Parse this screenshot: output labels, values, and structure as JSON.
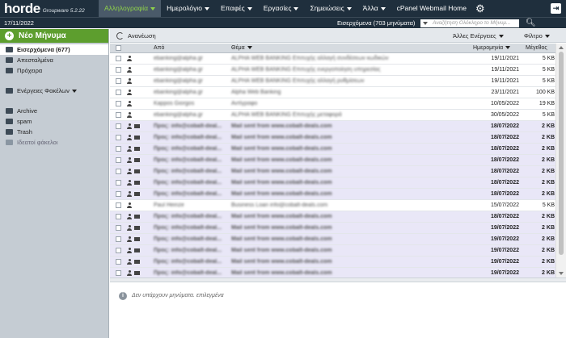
{
  "app": {
    "logo": "horde",
    "version": "Groupware 5.2.22"
  },
  "menu": [
    {
      "label": "Αλληλογραφία",
      "active": true,
      "caret": true
    },
    {
      "label": "Ημερολόγιο",
      "active": false,
      "caret": true
    },
    {
      "label": "Επαφές",
      "active": false,
      "caret": true
    },
    {
      "label": "Εργασίες",
      "active": false,
      "caret": true
    },
    {
      "label": "Σημειώσεις",
      "active": false,
      "caret": true
    },
    {
      "label": "Άλλα",
      "active": false,
      "caret": true
    },
    {
      "label": "cPanel Webmail Home",
      "active": false,
      "caret": false
    }
  ],
  "subbar": {
    "date": "17/11/2022",
    "folder": "Εισερχόμενα (703 μηνύματα)",
    "search_placeholder": "Αναζήτηση  Ολόκληρο το Μήνυμ..."
  },
  "sidebar": {
    "new_message": "Νέο Μήνυμα",
    "folders": [
      {
        "label": "Εισερχόμενα (677)",
        "icon": "inbox-icon",
        "selected": true
      },
      {
        "label": "Απεσταλμένα",
        "icon": "sent-icon",
        "selected": false
      },
      {
        "label": "Πρόχειρα",
        "icon": "drafts-icon",
        "selected": false
      }
    ],
    "folder_actions": "Ενέργειες Φακέλων",
    "extra": [
      {
        "label": "Archive",
        "icon": "folder-icon"
      },
      {
        "label": "spam",
        "icon": "folder-icon"
      },
      {
        "label": "Trash",
        "icon": "folder-icon"
      }
    ],
    "virtual": "Ιδεατοί φάκελοι"
  },
  "toolbar": {
    "refresh": "Ανανέωση",
    "other_actions": "Άλλες Ενέργειες",
    "filter": "Φίλτρο"
  },
  "headers": {
    "from": "Από",
    "subject": "Θέμα",
    "date": "Ημερομηνία",
    "size": "Μέγεθος"
  },
  "messages": [
    {
      "from": "ebanking@alpha.gr",
      "subject": "ALPHA WEB BANKING Επιτυχής αλλαγή συνδέσεων κωδικών",
      "date": "19/11/2021",
      "size": "5 KB",
      "unread": false,
      "envelope": false
    },
    {
      "from": "ebanking@alpha.gr",
      "subject": "ALPHA WEB BANKING Επιτυχής ενεργοποίηση υπηρεσίας",
      "date": "19/11/2021",
      "size": "5 KB",
      "unread": false,
      "envelope": false
    },
    {
      "from": "ebanking@alpha.gr",
      "subject": "ALPHA WEB BANKING Επιτυχής αλλαγή ρυθμίσεων",
      "date": "19/11/2021",
      "size": "5 KB",
      "unread": false,
      "envelope": false
    },
    {
      "from": "ebanking@alpha.gr",
      "subject": "Alpha Web Banking",
      "date": "23/11/2021",
      "size": "100 KB",
      "unread": false,
      "envelope": false
    },
    {
      "from": "Kappos Giorgos",
      "subject": "Αντίγραφο",
      "date": "10/05/2022",
      "size": "19 KB",
      "unread": false,
      "envelope": false
    },
    {
      "from": "ebanking@alpha.gr",
      "subject": "ALPHA WEB BANKING Επιτυχής μεταφορά",
      "date": "30/05/2022",
      "size": "5 KB",
      "unread": false,
      "envelope": false
    },
    {
      "from": "Προς: info@cobalt-deal...",
      "subject": "Mail sent from www.cobalt-deals.com",
      "date": "18/07/2022",
      "size": "2 KB",
      "unread": true,
      "envelope": true
    },
    {
      "from": "Προς: info@cobalt-deal...",
      "subject": "Mail sent from www.cobalt-deals.com",
      "date": "18/07/2022",
      "size": "2 KB",
      "unread": true,
      "envelope": true
    },
    {
      "from": "Προς: info@cobalt-deal...",
      "subject": "Mail sent from www.cobalt-deals.com",
      "date": "18/07/2022",
      "size": "2 KB",
      "unread": true,
      "envelope": true
    },
    {
      "from": "Προς: info@cobalt-deal...",
      "subject": "Mail sent from www.cobalt-deals.com",
      "date": "18/07/2022",
      "size": "2 KB",
      "unread": true,
      "envelope": true
    },
    {
      "from": "Προς: info@cobalt-deal...",
      "subject": "Mail sent from www.cobalt-deals.com",
      "date": "18/07/2022",
      "size": "2 KB",
      "unread": true,
      "envelope": true
    },
    {
      "from": "Προς: info@cobalt-deal...",
      "subject": "Mail sent from www.cobalt-deals.com",
      "date": "18/07/2022",
      "size": "2 KB",
      "unread": true,
      "envelope": true
    },
    {
      "from": "Προς: info@cobalt-deal...",
      "subject": "Mail sent from www.cobalt-deals.com",
      "date": "18/07/2022",
      "size": "2 KB",
      "unread": true,
      "envelope": true
    },
    {
      "from": "Paul Heinze",
      "subject": "Business Loan info@cobalt-deals.com",
      "date": "15/07/2022",
      "size": "5 KB",
      "unread": false,
      "envelope": false
    },
    {
      "from": "Προς: info@cobalt-deal...",
      "subject": "Mail sent from www.cobalt-deals.com",
      "date": "18/07/2022",
      "size": "2 KB",
      "unread": true,
      "envelope": true
    },
    {
      "from": "Προς: info@cobalt-deal...",
      "subject": "Mail sent from www.cobalt-deals.com",
      "date": "19/07/2022",
      "size": "2 KB",
      "unread": true,
      "envelope": true
    },
    {
      "from": "Προς: info@cobalt-deal...",
      "subject": "Mail sent from www.cobalt-deals.com",
      "date": "19/07/2022",
      "size": "2 KB",
      "unread": true,
      "envelope": true
    },
    {
      "from": "Προς: info@cobalt-deal...",
      "subject": "Mail sent from www.cobalt-deals.com",
      "date": "19/07/2022",
      "size": "2 KB",
      "unread": true,
      "envelope": true
    },
    {
      "from": "Προς: info@cobalt-deal...",
      "subject": "Mail sent from www.cobalt-deals.com",
      "date": "19/07/2022",
      "size": "2 KB",
      "unread": true,
      "envelope": true
    },
    {
      "from": "Προς: info@cobalt-deal...",
      "subject": "Mail sent from www.cobalt-deals.com",
      "date": "19/07/2022",
      "size": "2 KB",
      "unread": true,
      "envelope": true
    }
  ],
  "preview": {
    "empty_message": "Δεν υπάρχουν μηνύματα. επιλεγμένα"
  },
  "colors": {
    "topbar": "#1f2f3d",
    "new_message": "#5d9e2e",
    "active_menu": "#8fd24a",
    "unread_row": "#e9e7f7",
    "sidebar": "#c5ccd3"
  }
}
